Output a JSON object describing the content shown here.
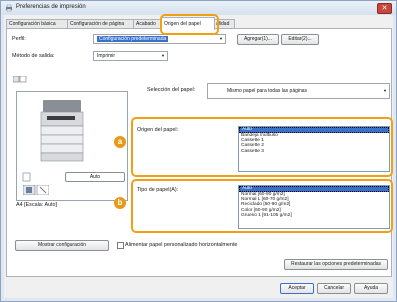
{
  "window": {
    "title": "Preferencias de impresión",
    "close": "✕"
  },
  "tabs": [
    {
      "label": "Configuración básica"
    },
    {
      "label": "Configuración de página"
    },
    {
      "label": "Acabado"
    },
    {
      "label": "Origen del papel"
    },
    {
      "label": "alidad"
    }
  ],
  "profile": {
    "label": "Perfil:",
    "value": "Configuración predeterminada",
    "add_button": "Agregar(1)...",
    "edit_button": "Editar(2)..."
  },
  "output_method": {
    "label": "Método de salida:",
    "value": "Imprimir"
  },
  "paper_selection": {
    "label": "Selección del papel:",
    "value": "Mismo papel para todas las páginas"
  },
  "paper_source": {
    "label": "Origen del papel:",
    "badge": "a",
    "options": [
      "Auto",
      "Bandeja multiuso",
      "Cassette 1",
      "Cassette 2",
      "Cassette 3"
    ],
    "selected": "Auto"
  },
  "paper_type": {
    "label": "Tipo de papel(A):",
    "badge": "b",
    "options": [
      "Auto",
      "Normal [60-90 g/m2]",
      "Normal L [60-70 g/m2]",
      "Reciclado [60-90 g/m2]",
      "Color [60-90 g/m2]",
      "Grueso 1 [91-105 g/m2]"
    ],
    "selected": "Auto"
  },
  "preview": {
    "source_label": "Auto",
    "caption": "A4 [Escala: Auto]"
  },
  "bottom": {
    "show_settings": "Mostrar configuración",
    "custom_paper_checkbox": "Alimentar papel personalizado horizontalmente",
    "restore_defaults": "Restaurar las opciones predeterminadas"
  },
  "dialog_buttons": {
    "ok": "Aceptar",
    "cancel": "Cancelar",
    "help": "Ayuda"
  }
}
